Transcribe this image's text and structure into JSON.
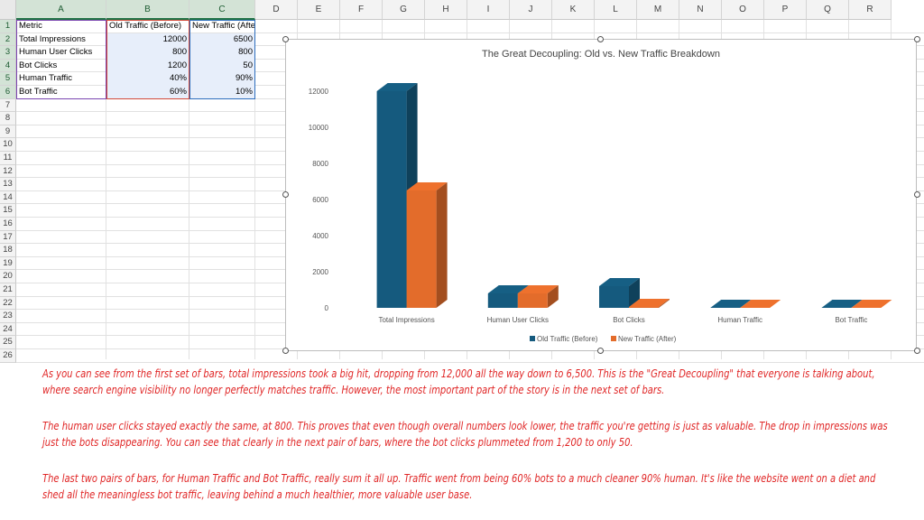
{
  "columns": [
    "A",
    "B",
    "C",
    "D",
    "E",
    "F",
    "G",
    "H",
    "I",
    "J",
    "K",
    "L",
    "M",
    "N",
    "O",
    "P",
    "Q",
    "R"
  ],
  "rows": [
    "1",
    "2",
    "3",
    "4",
    "5",
    "6",
    "7",
    "8",
    "9",
    "10",
    "11",
    "12",
    "13",
    "14",
    "15",
    "16",
    "17",
    "18",
    "19",
    "20",
    "21",
    "22",
    "23",
    "24",
    "25",
    "26"
  ],
  "table": {
    "headers": [
      "Metric",
      "Old Traffic (Before)",
      "New Traffic (After)"
    ],
    "rows": [
      [
        "Total Impressions",
        "12000",
        "6500"
      ],
      [
        "Human User Clicks",
        "800",
        "800"
      ],
      [
        "Bot Clicks",
        "1200",
        "50"
      ],
      [
        "Human Traffic",
        "40%",
        "90%"
      ],
      [
        "Bot Traffic",
        "60%",
        "10%"
      ]
    ]
  },
  "chart_data": {
    "type": "bar",
    "title": "The Great Decoupling: Old vs. New Traffic Breakdown",
    "categories": [
      "Total Impressions",
      "Human User Clicks",
      "Bot Clicks",
      "Human Traffic",
      "Bot Traffic"
    ],
    "series": [
      {
        "name": "Old Traffic (Before)",
        "values": [
          12000,
          800,
          1200,
          0.4,
          0.6
        ],
        "color": "#155a7e"
      },
      {
        "name": "New Traffic (After)",
        "values": [
          6500,
          800,
          50,
          0.9,
          0.1
        ],
        "color": "#e36c2b"
      }
    ],
    "yticks": [
      "0",
      "2000",
      "4000",
      "6000",
      "8000",
      "10000",
      "12000"
    ],
    "ylim": [
      0,
      12000
    ],
    "grid": false,
    "legend_position": "bottom",
    "style": "3d-clustered-column"
  },
  "notes": [
    "As you can see from the first set of bars, total impressions took a big hit, dropping from 12,000 all the way down to 6,500. This is the \"Great Decoupling\" that everyone is talking about, where search engine visibility no longer perfectly matches traffic. However, the most important part of the story is in the next set of bars.",
    "The human user clicks stayed exactly the same, at 800. This proves that even though overall numbers look lower, the traffic you're getting is just as valuable. The drop in impressions was just the bots disappearing. You can see that clearly in the next pair of bars, where the bot clicks plummeted from 1,200 to only 50.",
    "The last two pairs of bars, for Human Traffic and Bot Traffic, really sum it all up. Traffic went from being 60% bots to a much cleaner 90% human. It's like the website went on a diet and shed all the meaningless bot traffic, leaving behind a much healthier, more valuable user base."
  ]
}
